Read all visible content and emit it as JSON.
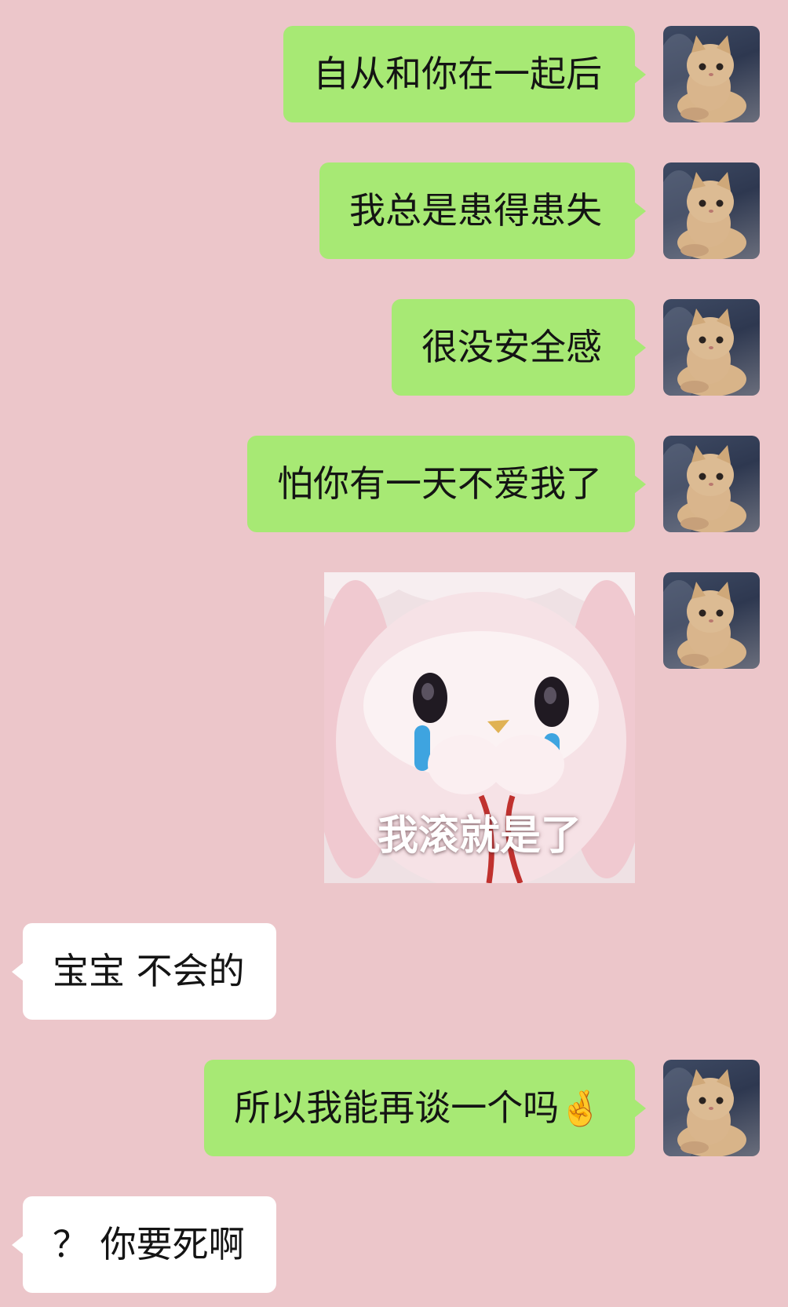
{
  "messages": [
    {
      "side": "out",
      "text": "自从和你在一起后"
    },
    {
      "side": "out",
      "text": "我总是患得患失"
    },
    {
      "side": "out",
      "text": "很没安全感"
    },
    {
      "side": "out",
      "text": "怕你有一天不爱我了"
    },
    {
      "side": "out",
      "type": "sticker",
      "caption": "我滚就是了"
    },
    {
      "side": "in",
      "text": "宝宝 不会的"
    },
    {
      "side": "out",
      "text": "所以我能再谈一个吗",
      "emoji": "🤞",
      "emoji_name": "crossed-fingers-icon"
    },
    {
      "side": "in",
      "text": "？ 你要死啊"
    }
  ],
  "avatar": {
    "icon": "kitten-avatar"
  },
  "colors": {
    "background": "#ecc6ca",
    "outgoing_bubble": "#a7e974",
    "incoming_bubble": "#ffffff"
  }
}
